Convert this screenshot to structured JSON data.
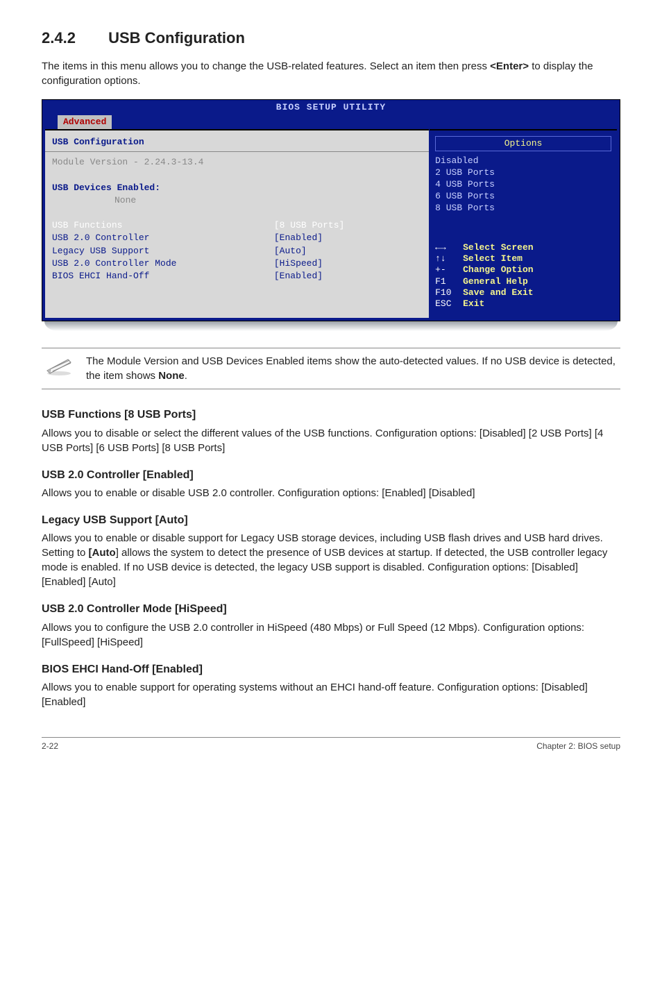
{
  "heading": {
    "num": "2.4.2",
    "title": "USB Configuration"
  },
  "intro": "The items in this menu allows you to change the USB-related features. Select an item then press <Enter> to display the configuration options.",
  "bios": {
    "utility_title": "BIOS SETUP UTILITY",
    "tab": "Advanced",
    "left": {
      "header": "USB Configuration",
      "module_version": "Module Version - 2.24.3-13.4",
      "devices_enabled_label": "USB Devices Enabled:",
      "devices_enabled_value": "None",
      "rows": [
        {
          "label": "USB Functions",
          "value": "[8 USB Ports]",
          "white": true
        },
        {
          "label": "USB 2.0 Controller",
          "value": "[Enabled]",
          "white": false
        },
        {
          "label": "Legacy USB Support",
          "value": "[Auto]",
          "white": false
        },
        {
          "label": "USB 2.0 Controller Mode",
          "value": "[HiSpeed]",
          "white": false
        },
        {
          "label": "BIOS EHCI Hand-Off",
          "value": "[Enabled]",
          "white": false
        }
      ]
    },
    "right": {
      "options_header": "Options",
      "options": [
        "Disabled",
        "2 USB Ports",
        "4 USB Ports",
        "6 USB Ports",
        "8 USB Ports"
      ],
      "keys": [
        {
          "k": "←→",
          "d": "Select Screen"
        },
        {
          "k": "↑↓",
          "d": "Select Item"
        },
        {
          "k": "+-",
          "d": "Change Option"
        },
        {
          "k": "F1",
          "d": "General Help"
        },
        {
          "k": "F10",
          "d": "Save and Exit"
        },
        {
          "k": "ESC",
          "d": "Exit"
        }
      ]
    }
  },
  "note": "The Module Version and USB Devices Enabled items show the auto-detected values. If no USB device is detected, the item shows None.",
  "note_bold_last": "None",
  "sections": [
    {
      "title": "USB Functions [8 USB Ports]",
      "body": "Allows you to disable or select the different values of the USB functions. Configuration options: [Disabled] [2 USB Ports] [4 USB Ports] [6 USB Ports] [8 USB Ports]"
    },
    {
      "title": "USB 2.0 Controller [Enabled]",
      "body": "Allows you to enable or disable USB 2.0 controller. Configuration options: [Enabled] [Disabled]"
    },
    {
      "title": "Legacy USB Support [Auto]",
      "body": "Allows you to enable or disable support for Legacy USB storage devices, including USB flash drives and USB hard drives. Setting to [Auto] allows the system to detect the presence of USB devices at startup. If detected, the USB controller legacy mode is enabled. If no USB device is detected, the legacy USB support is disabled. Configuration options: [Disabled] [Enabled] [Auto]",
      "bold": "[Auto"
    },
    {
      "title": "USB 2.0 Controller Mode [HiSpeed]",
      "body": "Allows you to configure the USB 2.0 controller in HiSpeed (480 Mbps) or Full Speed (12 Mbps). Configuration options: [FullSpeed] [HiSpeed]"
    },
    {
      "title": "BIOS EHCI Hand-Off [Enabled]",
      "body": "Allows you to enable support for operating systems without an EHCI hand-off feature. Configuration options: [Disabled] [Enabled]"
    }
  ],
  "footer": {
    "left": "2-22",
    "right": "Chapter 2: BIOS setup"
  }
}
